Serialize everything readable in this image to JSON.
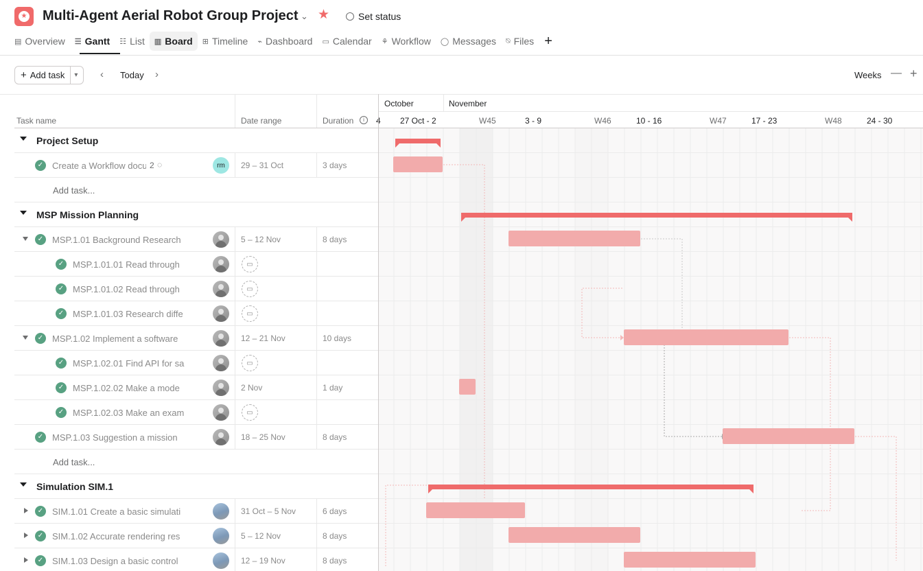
{
  "header": {
    "title": "Multi-Agent Aerial Robot Group Project",
    "set_status": "Set status",
    "brand_color": "#f06a6a",
    "icons": {
      "app": "project-icon",
      "star": "star-icon",
      "chevron": "chevron-down-icon"
    }
  },
  "tabs": [
    {
      "label": "Overview",
      "icon": "overview-icon"
    },
    {
      "label": "Gantt",
      "icon": "gantt-icon"
    },
    {
      "label": "List",
      "icon": "list-icon"
    },
    {
      "label": "Board",
      "icon": "board-icon"
    },
    {
      "label": "Timeline",
      "icon": "timeline-icon"
    },
    {
      "label": "Dashboard",
      "icon": "dashboard-icon"
    },
    {
      "label": "Calendar",
      "icon": "calendar-icon"
    },
    {
      "label": "Workflow",
      "icon": "workflow-icon"
    },
    {
      "label": "Messages",
      "icon": "messages-icon"
    },
    {
      "label": "Files",
      "icon": "files-icon"
    }
  ],
  "toolbar": {
    "add_task": "Add task",
    "today": "Today",
    "zoom_unit": "Weeks"
  },
  "columns": {
    "task_name": "Task name",
    "date_range": "Date range",
    "duration": "Duration"
  },
  "timeline": {
    "months": [
      "October",
      "November"
    ],
    "weeks": [
      {
        "num": "",
        "range": "27 Oct - 2"
      },
      {
        "num": "W45",
        "range": "3 - 9"
      },
      {
        "num": "W46",
        "range": "10 - 16"
      },
      {
        "num": "W47",
        "range": "17 - 23"
      },
      {
        "num": "W48",
        "range": "24 - 30"
      }
    ],
    "bar_color": "#f2abab",
    "section_bar_color": "#ef6b6b"
  },
  "sections": [
    {
      "name": "Project Setup",
      "tasks": [
        {
          "name": "Create a Workflow document",
          "comments": "2",
          "assignee": "rm",
          "date": "29 – 31 Oct",
          "duration": "3 days"
        }
      ],
      "add_task": "Add task..."
    },
    {
      "name": "MSP Mission Planning",
      "tasks": [
        {
          "name": "MSP.1.01 Background Research",
          "date": "5 – 12 Nov",
          "duration": "8 days"
        },
        {
          "name": "MSP.1.01.01 Read through",
          "date": "",
          "duration": ""
        },
        {
          "name": "MSP.1.01.02 Read through",
          "date": "",
          "duration": ""
        },
        {
          "name": "MSP.1.01.03 Research diffe",
          "date": "",
          "duration": ""
        },
        {
          "name": "MSP.1.02 Implement a software",
          "date": "12 – 21 Nov",
          "duration": "10 days"
        },
        {
          "name": "MSP.1.02.01 Find API for sa",
          "date": "",
          "duration": ""
        },
        {
          "name": "MSP.1.02.02 Make a mode",
          "date": "2 Nov",
          "duration": "1 day"
        },
        {
          "name": "MSP.1.02.03 Make an exam",
          "date": "",
          "duration": ""
        },
        {
          "name": "MSP.1.03 Suggestion a mission",
          "date": "18 – 25 Nov",
          "duration": "8 days"
        }
      ],
      "add_task": "Add task..."
    },
    {
      "name": "Simulation SIM.1",
      "tasks": [
        {
          "name": "SIM.1.01 Create a basic simulati",
          "date": "31 Oct – 5 Nov",
          "duration": "6 days"
        },
        {
          "name": "SIM.1.02 Accurate rendering res",
          "date": "5 – 12 Nov",
          "duration": "8 days"
        },
        {
          "name": "SIM.1.03 Design a basic control",
          "date": "12 – 19 Nov",
          "duration": "8 days"
        }
      ]
    }
  ]
}
